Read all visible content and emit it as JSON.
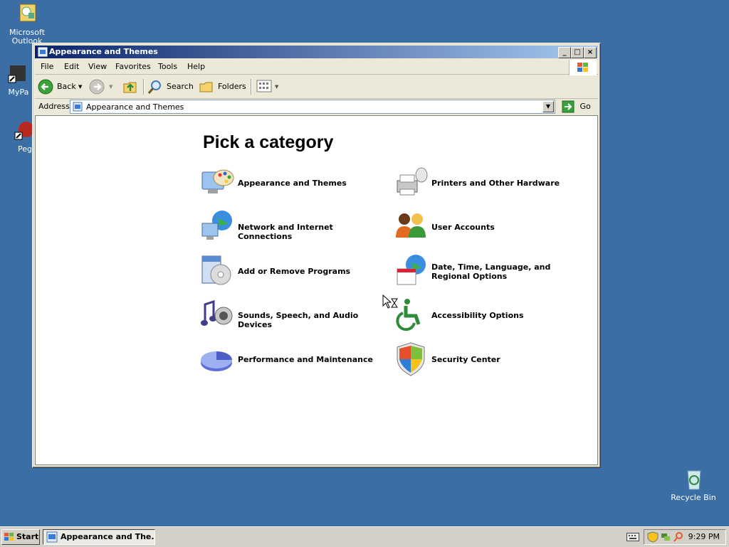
{
  "desktop": {
    "icons": [
      {
        "label": "Microsoft Outlook"
      },
      {
        "label": "MyPa"
      },
      {
        "label": "Peg"
      },
      {
        "label": "Recycle Bin"
      }
    ]
  },
  "window": {
    "title": "Appearance and Themes",
    "menu": [
      "File",
      "Edit",
      "View",
      "Favorites",
      "Tools",
      "Help"
    ],
    "toolbar": {
      "back_label": "Back",
      "search_label": "Search",
      "folders_label": "Folders"
    },
    "address": {
      "label": "Address",
      "value": "Appearance and Themes",
      "go_label": "Go"
    }
  },
  "content": {
    "heading": "Pick a category",
    "categories": [
      {
        "label": "Appearance and Themes",
        "icon": "appearance-themes-icon"
      },
      {
        "label": "Printers and Other Hardware",
        "icon": "printer-icon"
      },
      {
        "label": "Network and Internet Connections",
        "icon": "network-icon"
      },
      {
        "label": "User Accounts",
        "icon": "user-accounts-icon"
      },
      {
        "label": "Add or Remove Programs",
        "icon": "add-remove-programs-icon"
      },
      {
        "label": "Date, Time, Language, and Regional Options",
        "icon": "date-time-icon"
      },
      {
        "label": "Sounds, Speech, and Audio Devices",
        "icon": "sound-icon"
      },
      {
        "label": "Accessibility Options",
        "icon": "accessibility-icon"
      },
      {
        "label": "Performance and Maintenance",
        "icon": "performance-icon"
      },
      {
        "label": "Security Center",
        "icon": "security-shield-icon"
      }
    ]
  },
  "taskbar": {
    "start_label": "Start",
    "task_label": "Appearance and The...",
    "clock": "9:29 PM"
  },
  "colors": {
    "desktop": "#3a6ea5",
    "title_start": "#0a246a",
    "title_end": "#a6caf0"
  }
}
